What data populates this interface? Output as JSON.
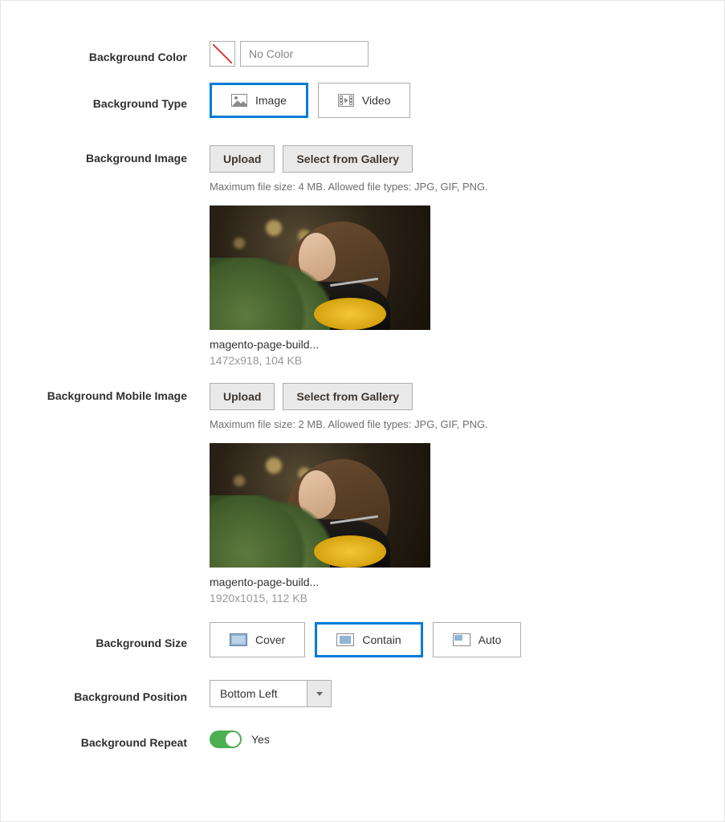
{
  "labels": {
    "bg_color": "Background Color",
    "bg_type": "Background Type",
    "bg_image": "Background Image",
    "bg_mobile_image": "Background Mobile Image",
    "bg_size": "Background Size",
    "bg_position": "Background Position",
    "bg_repeat": "Background Repeat"
  },
  "bg_color": {
    "placeholder": "No Color"
  },
  "bg_type": {
    "options": {
      "image": "Image",
      "video": "Video"
    },
    "selected": "image"
  },
  "buttons": {
    "upload": "Upload",
    "select_gallery": "Select from Gallery"
  },
  "bg_image": {
    "help": "Maximum file size: 4 MB. Allowed file types: JPG, GIF, PNG.",
    "file_name": "magento-page-build...",
    "file_meta": "1472x918, 104 KB"
  },
  "bg_mobile_image": {
    "help": "Maximum file size: 2 MB. Allowed file types: JPG, GIF, PNG.",
    "file_name": "magento-page-build...",
    "file_meta": "1920x1015, 112 KB"
  },
  "bg_size": {
    "options": {
      "cover": "Cover",
      "contain": "Contain",
      "auto": "Auto"
    },
    "selected": "contain"
  },
  "bg_position": {
    "value": "Bottom Left"
  },
  "bg_repeat": {
    "value_label": "Yes"
  }
}
